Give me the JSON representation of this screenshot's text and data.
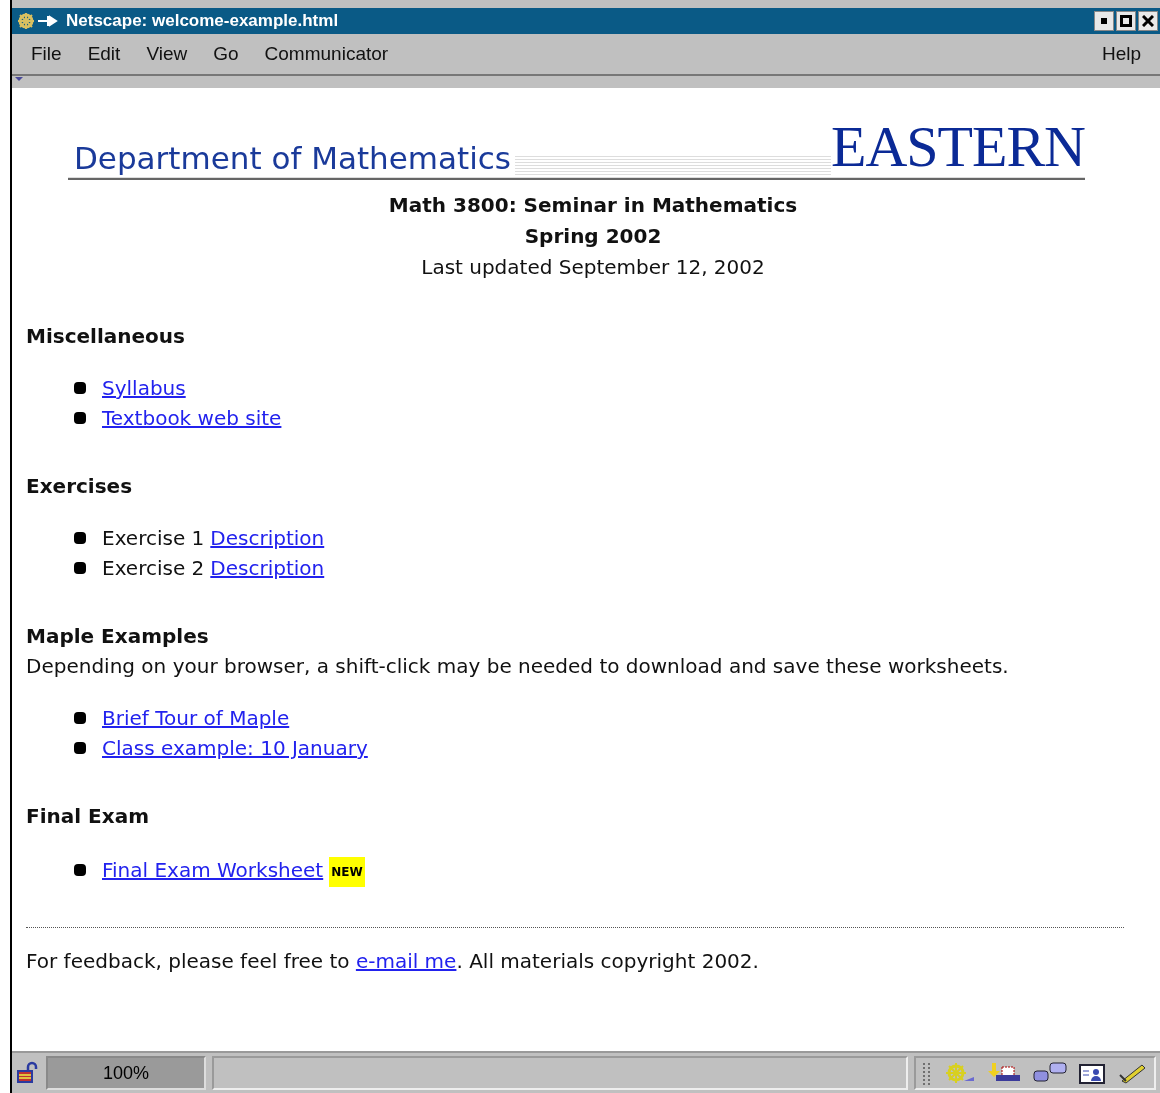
{
  "window": {
    "title": "Netscape: welcome-example.html"
  },
  "menu": [
    {
      "label": "File"
    },
    {
      "label": "Edit"
    },
    {
      "label": "View"
    },
    {
      "label": "Go"
    },
    {
      "label": "Communicator"
    },
    {
      "label": "Help"
    }
  ],
  "banner": {
    "department": "Department of Mathematics",
    "logo": "EASTERN"
  },
  "course": {
    "title": "Math 3800: Seminar in Mathematics",
    "term": "Spring 2002",
    "updated": "Last updated September 12, 2002"
  },
  "sections": [
    {
      "heading": "Miscellaneous",
      "items": [
        {
          "link": "Syllabus"
        },
        {
          "link": "Textbook web site"
        }
      ]
    },
    {
      "heading": "Exercises",
      "items": [
        {
          "text": "Exercise 1",
          "link": "Description"
        },
        {
          "text": "Exercise 2",
          "link": "Description"
        }
      ]
    },
    {
      "heading": "Maple Examples",
      "intro": "Depending on your browser, a shift-click may be needed to download and save these worksheets.",
      "items": [
        {
          "link": "Brief Tour of Maple"
        },
        {
          "link": "Class example: 10 January"
        }
      ]
    },
    {
      "heading": "Final Exam",
      "items": [
        {
          "link": "Final Exam Worksheet",
          "badge": "NEW"
        }
      ]
    }
  ],
  "footer": {
    "before": "For feedback, please feel free to ",
    "link": "e-mail me",
    "after": ". All materials copyright 2002."
  },
  "status_bar": {
    "zoom": "100%"
  }
}
